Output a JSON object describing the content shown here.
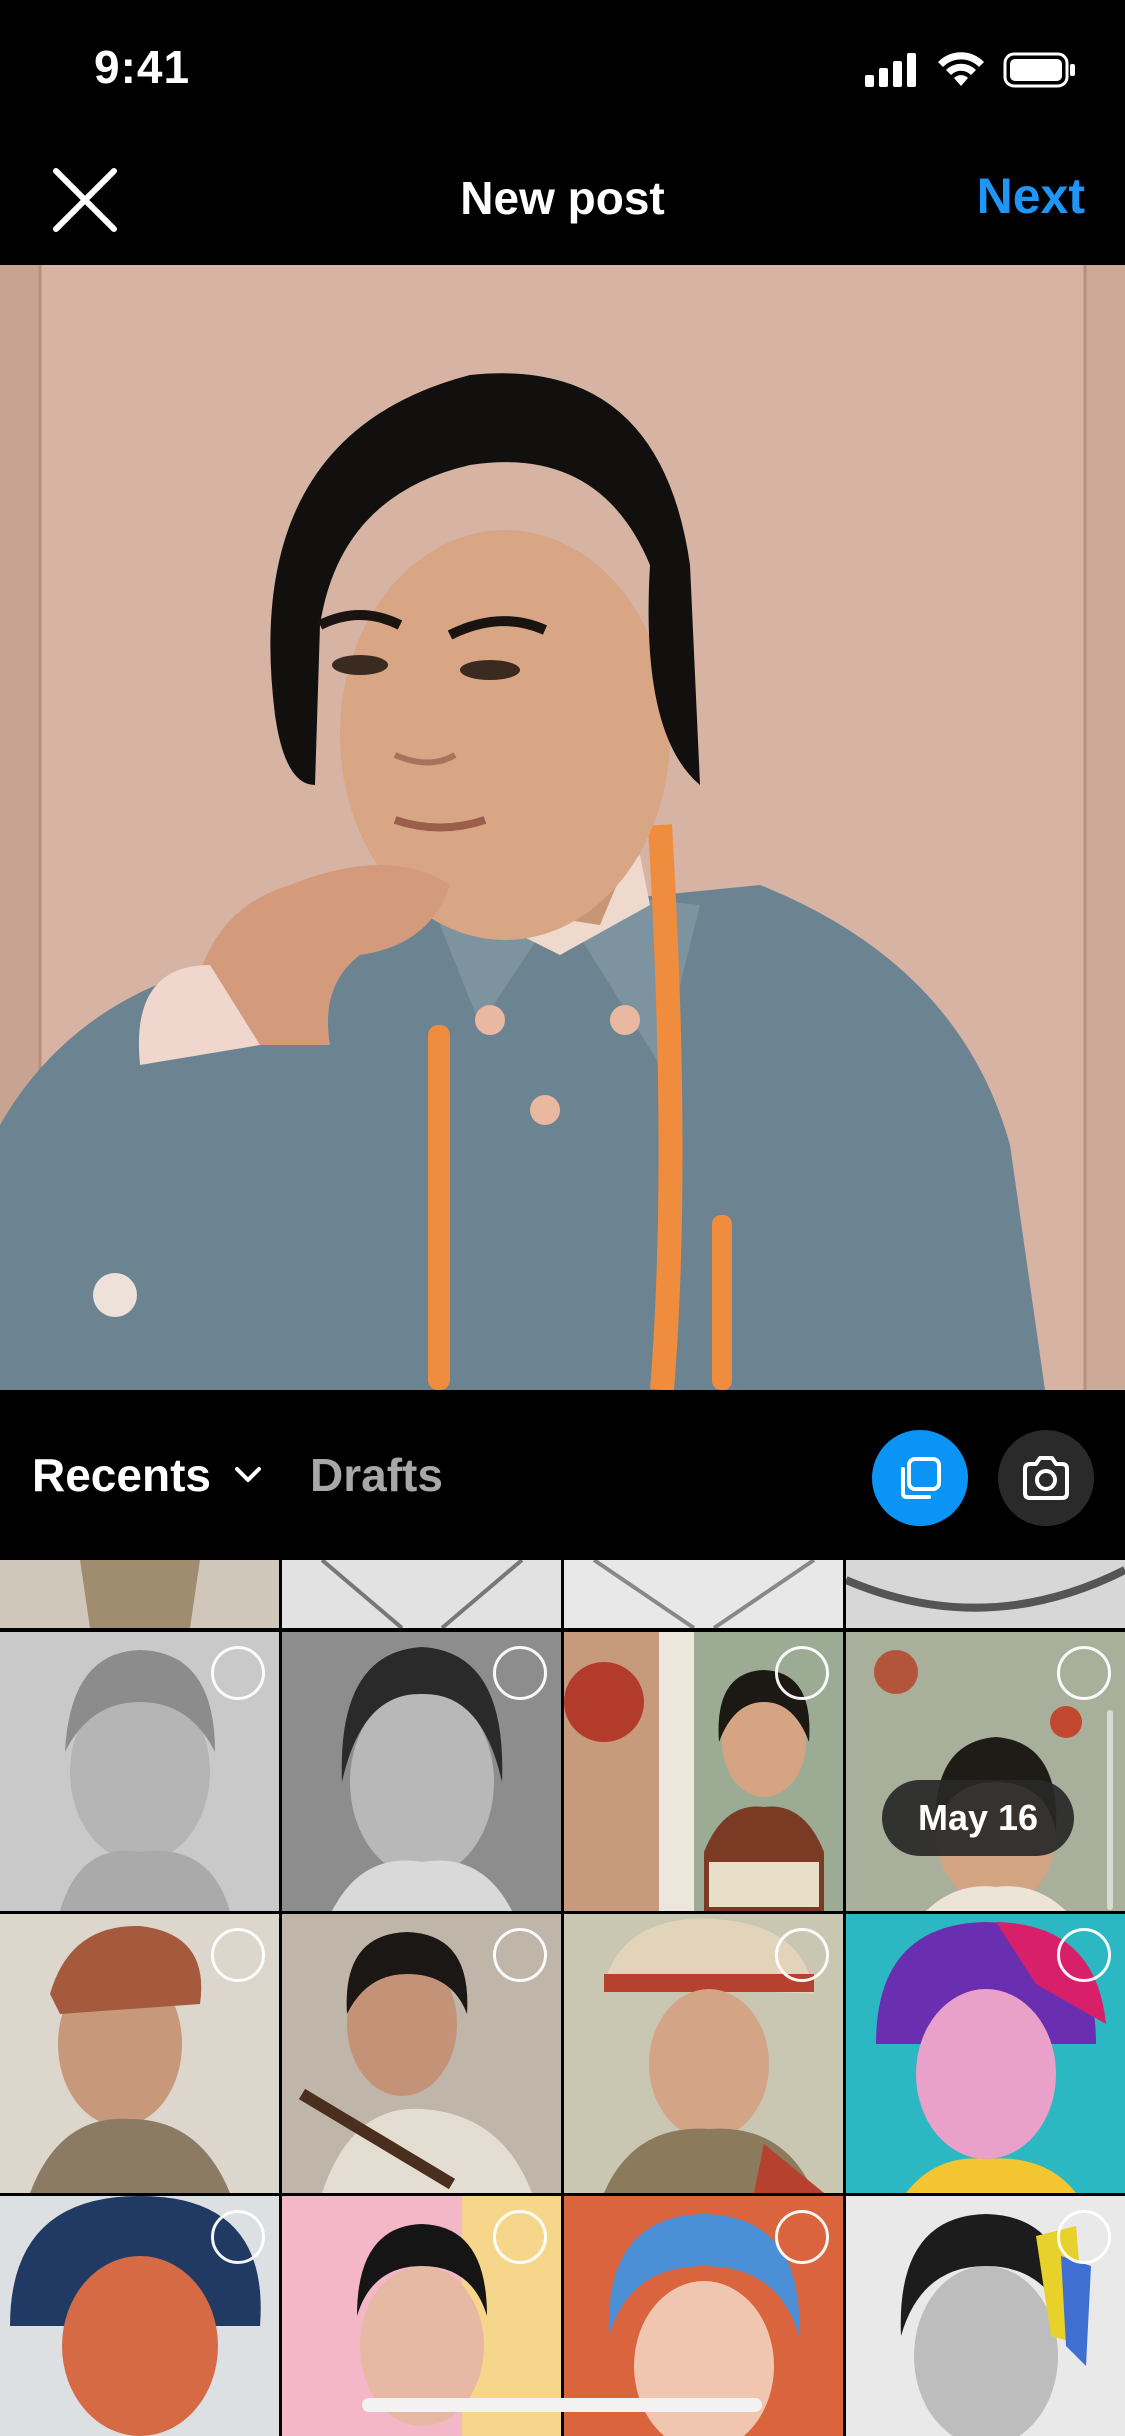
{
  "status_bar": {
    "time": "9:41",
    "icons": [
      "cellular-signal-icon",
      "wifi-icon",
      "battery-icon"
    ]
  },
  "header": {
    "close_icon": "close-icon",
    "title": "New post",
    "next_label": "Next"
  },
  "gallery": {
    "source_label": "Recents",
    "source_icon": "chevron-down-icon",
    "drafts_label": "Drafts",
    "multi_select_icon": "multi-select-icon",
    "camera_icon": "camera-icon",
    "date_label": "May 16"
  },
  "colors": {
    "accent": "#1f95f5",
    "multi_select_bg": "#0a95f6",
    "camera_bg": "#2a2a2a",
    "muted_text": "#a7a7a7",
    "background": "#000000"
  }
}
